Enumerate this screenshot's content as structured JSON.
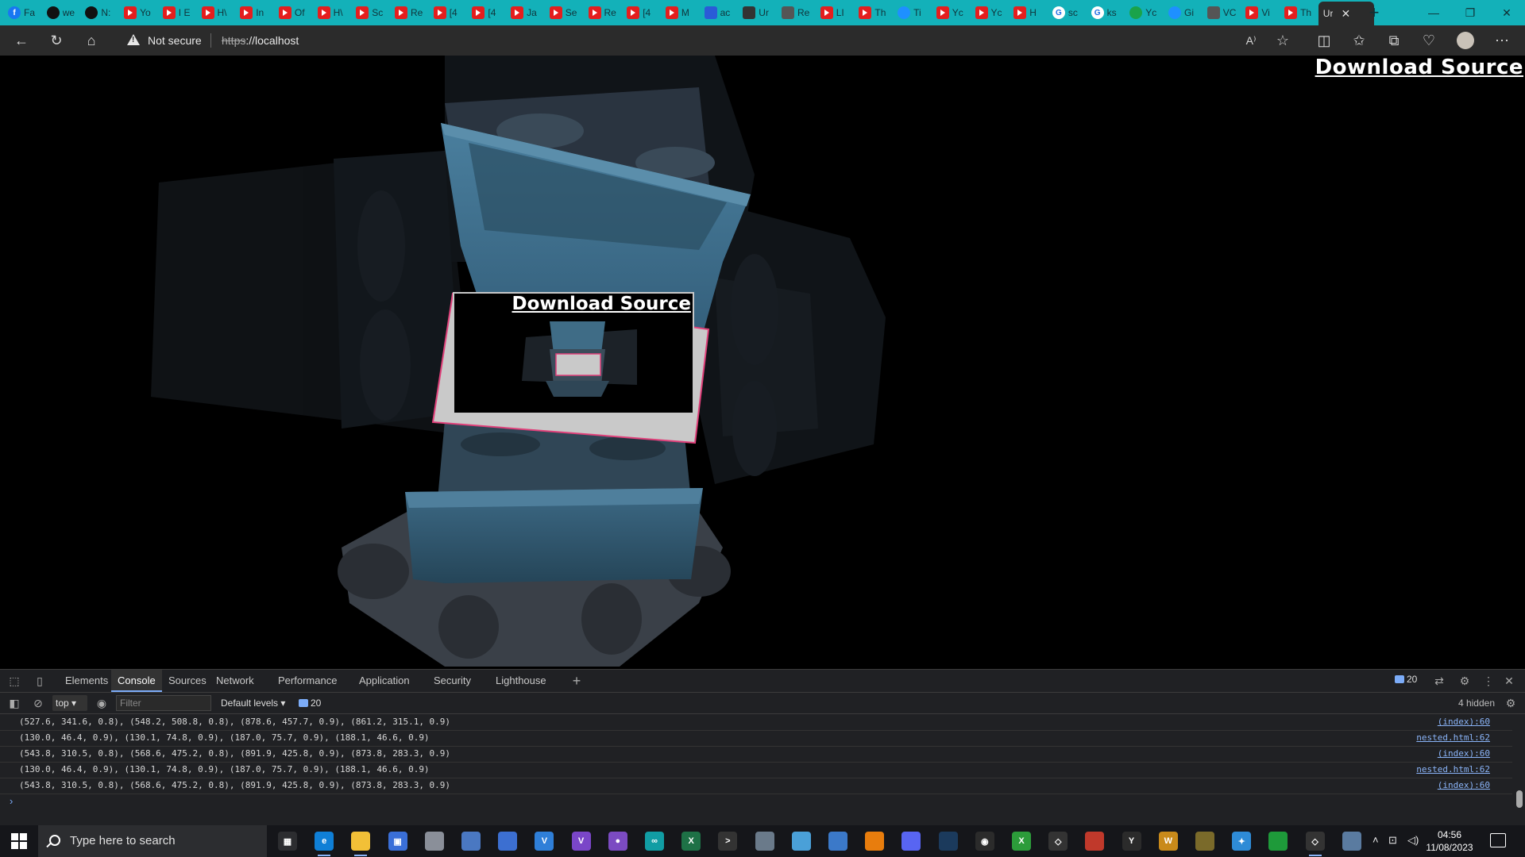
{
  "browser": {
    "tabs": [
      {
        "label": "Fa",
        "icon": "facebook-icon",
        "kind": "fb"
      },
      {
        "label": "we",
        "icon": "github-icon",
        "kind": "gh"
      },
      {
        "label": "N:",
        "icon": "github-icon",
        "kind": "gh"
      },
      {
        "label": "Yo",
        "icon": "youtube-icon",
        "kind": "yt"
      },
      {
        "label": "I E",
        "icon": "youtube-icon",
        "kind": "yt"
      },
      {
        "label": "H\\",
        "icon": "youtube-icon",
        "kind": "yt"
      },
      {
        "label": "In",
        "icon": "youtube-icon",
        "kind": "yt"
      },
      {
        "label": "Of",
        "icon": "youtube-icon",
        "kind": "yt"
      },
      {
        "label": "H\\",
        "icon": "youtube-icon",
        "kind": "yt"
      },
      {
        "label": "Sc",
        "icon": "youtube-icon",
        "kind": "yt"
      },
      {
        "label": "Re",
        "icon": "youtube-icon",
        "kind": "yt"
      },
      {
        "label": "[4",
        "icon": "youtube-icon",
        "kind": "yt"
      },
      {
        "label": "[4",
        "icon": "youtube-icon",
        "kind": "yt"
      },
      {
        "label": "Ja",
        "icon": "youtube-icon",
        "kind": "yt"
      },
      {
        "label": "Se",
        "icon": "youtube-icon",
        "kind": "yt"
      },
      {
        "label": "Re",
        "icon": "youtube-icon",
        "kind": "yt"
      },
      {
        "label": "[4",
        "icon": "youtube-icon",
        "kind": "yt"
      },
      {
        "label": "M",
        "icon": "youtube-icon",
        "kind": "yt"
      },
      {
        "label": "ac",
        "icon": "document-icon",
        "kind": "ms"
      },
      {
        "label": "Ur",
        "icon": "unity-icon",
        "kind": "ot"
      },
      {
        "label": "Re",
        "icon": "speaker-muted-icon",
        "kind": "sp"
      },
      {
        "label": "LI",
        "icon": "youtube-icon",
        "kind": "yt"
      },
      {
        "label": "Th",
        "icon": "youtube-icon",
        "kind": "yt"
      },
      {
        "label": "Ti",
        "icon": "sparkle-icon",
        "kind": "ed"
      },
      {
        "label": "Yc",
        "icon": "youtube-icon",
        "kind": "yt"
      },
      {
        "label": "Yc",
        "icon": "youtube-icon",
        "kind": "yt"
      },
      {
        "label": "H",
        "icon": "youtube-icon",
        "kind": "yt"
      },
      {
        "label": "sc",
        "icon": "globe-icon",
        "kind": "gg"
      },
      {
        "label": "ks",
        "icon": "google-icon",
        "kind": "gg"
      },
      {
        "label": "Yc",
        "icon": "dot-icon",
        "kind": "gr"
      },
      {
        "label": "Gi",
        "icon": "globe-icon",
        "kind": "ed"
      },
      {
        "label": "VC",
        "icon": "speaker-icon",
        "kind": "sp"
      },
      {
        "label": "Vi",
        "icon": "youtube-icon",
        "kind": "yt"
      },
      {
        "label": "Th",
        "icon": "youtube-icon",
        "kind": "yt"
      }
    ],
    "active_tab": {
      "label": "Ur",
      "close": "✕"
    },
    "new_tab": "+",
    "window": {
      "minimize": "—",
      "restore": "❐",
      "close": "✕"
    },
    "address": {
      "security": "Not secure",
      "scheme": "https",
      "rest": "://localhost"
    },
    "accent": "#13b1b9"
  },
  "page": {
    "download_link": "Download Source",
    "nested_download_link": "Download Source"
  },
  "devtools": {
    "tabs": [
      "Elements",
      "Console",
      "Sources",
      "Network",
      "Performance",
      "Application",
      "Security",
      "Lighthouse"
    ],
    "active_tab": "Console",
    "add_tab": "+",
    "message_count": "20",
    "context": "top",
    "filter_placeholder": "Filter",
    "levels": "Default levels",
    "filter_count": "20",
    "hidden": "4 hidden",
    "logs": [
      {
        "msg": "(527.6, 341.6, 0.8), (548.2, 508.8, 0.8), (878.6, 457.7, 0.9), (861.2, 315.1, 0.9)",
        "src": "(index):60"
      },
      {
        "msg": "(130.0, 46.4, 0.9), (130.1, 74.8, 0.9), (187.0, 75.7, 0.9), (188.1, 46.6, 0.9)",
        "src": "nested.html:62"
      },
      {
        "msg": "(543.8, 310.5, 0.8), (568.6, 475.2, 0.8), (891.9, 425.8, 0.9), (873.8, 283.3, 0.9)",
        "src": "(index):60"
      },
      {
        "msg": "(130.0, 46.4, 0.9), (130.1, 74.8, 0.9), (187.0, 75.7, 0.9), (188.1, 46.6, 0.9)",
        "src": "nested.html:62"
      },
      {
        "msg": "(543.8, 310.5, 0.8), (568.6, 475.2, 0.8), (891.9, 425.8, 0.9), (873.8, 283.3, 0.9)",
        "src": "(index):60"
      }
    ],
    "prompt": "›"
  },
  "taskbar": {
    "search_placeholder": "Type here to search",
    "apps": [
      {
        "name": "task-view-icon",
        "color": "#2c2d30",
        "glyph": "▦"
      },
      {
        "name": "edge-icon",
        "color": "#0f7fd6",
        "glyph": "e"
      },
      {
        "name": "file-explorer-icon",
        "color": "#f2c037",
        "glyph": ""
      },
      {
        "name": "store-icon",
        "color": "#3a6fd8",
        "glyph": "▣"
      },
      {
        "name": "app-icon",
        "color": "#8a8f99",
        "glyph": ""
      },
      {
        "name": "app-icon",
        "color": "#4a78c2",
        "glyph": ""
      },
      {
        "name": "app-icon",
        "color": "#3c6fd1",
        "glyph": ""
      },
      {
        "name": "vscode-icon",
        "color": "#2f7fd8",
        "glyph": "V"
      },
      {
        "name": "visual-studio-icon",
        "color": "#7a46c8",
        "glyph": "V"
      },
      {
        "name": "github-desktop-icon",
        "color": "#7b4bc2",
        "glyph": "●"
      },
      {
        "name": "arduino-icon",
        "color": "#119da4",
        "glyph": "∞"
      },
      {
        "name": "excel-icon",
        "color": "#1e7146",
        "glyph": "X"
      },
      {
        "name": "terminal-icon",
        "color": "#333",
        "glyph": ">"
      },
      {
        "name": "app-icon",
        "color": "#6a7a8a",
        "glyph": ""
      },
      {
        "name": "app-icon",
        "color": "#4aa0d8",
        "glyph": ""
      },
      {
        "name": "app-icon",
        "color": "#3b79c9",
        "glyph": ""
      },
      {
        "name": "blender-icon",
        "color": "#e87d0d",
        "glyph": ""
      },
      {
        "name": "discord-icon",
        "color": "#5865f2",
        "glyph": ""
      },
      {
        "name": "steam-icon",
        "color": "#1b3a5c",
        "glyph": ""
      },
      {
        "name": "obs-icon",
        "color": "#2b2b2b",
        "glyph": "◉"
      },
      {
        "name": "xbox-icon",
        "color": "#2c9c3a",
        "glyph": "X"
      },
      {
        "name": "unity-icon",
        "color": "#333",
        "glyph": "◇"
      },
      {
        "name": "app-icon",
        "color": "#c0392b",
        "glyph": ""
      },
      {
        "name": "app-icon",
        "color": "#2b2b2b",
        "glyph": "Y"
      },
      {
        "name": "app-icon",
        "color": "#c98a1a",
        "glyph": "W"
      },
      {
        "name": "app-icon",
        "color": "#7a6a2a",
        "glyph": ""
      },
      {
        "name": "app-icon",
        "color": "#2e8bd6",
        "glyph": "✦"
      },
      {
        "name": "app-icon",
        "color": "#1e9a3a",
        "glyph": ""
      },
      {
        "name": "unity-icon",
        "color": "#333",
        "glyph": "◇"
      },
      {
        "name": "app-icon",
        "color": "#5a7ba0",
        "glyph": ""
      }
    ],
    "time": "04:56",
    "date": "11/08/2023"
  }
}
